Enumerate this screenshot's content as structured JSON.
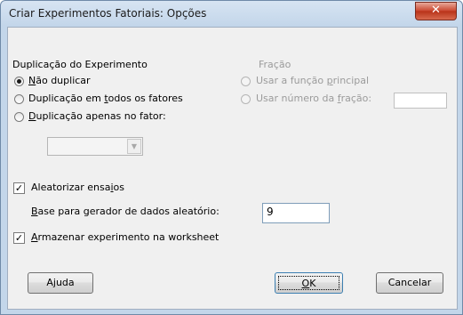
{
  "window": {
    "title": "Criar Experimentos Fatoriais: Opções",
    "close_glyph": "✕"
  },
  "duplication": {
    "heading": "Duplicação do Experimento",
    "options": [
      {
        "pre": "",
        "ul": "N",
        "post": "ão duplicar",
        "selected": true
      },
      {
        "pre": "Duplicação em ",
        "ul": "t",
        "post": "odos os fatores",
        "selected": false
      },
      {
        "pre": "",
        "ul": "D",
        "post": "uplicação apenas no fator:",
        "selected": false
      }
    ],
    "factor_select": {
      "value": "",
      "disabled": true
    }
  },
  "fraction": {
    "heading": "Fração",
    "opt1": {
      "pre": "Usar a função ",
      "ul": "p",
      "post": "rincipal"
    },
    "opt2": {
      "pre": "Usar número da ",
      "ul": "f",
      "post": "ração:"
    },
    "number_value": ""
  },
  "randomize": {
    "label_pre": "Aleatorizar ensa",
    "label_ul": "i",
    "label_post": "os",
    "checked": true
  },
  "seed": {
    "label_ul": "B",
    "label_post": "ase para gerador de dados aleatório:",
    "value": "9"
  },
  "store": {
    "label_ul": "A",
    "label_post": "rmazenar experimento na worksheet",
    "checked": true
  },
  "buttons": {
    "help": "Ajuda",
    "ok_ul": "O",
    "ok_post": "K",
    "cancel": "Cancelar"
  }
}
